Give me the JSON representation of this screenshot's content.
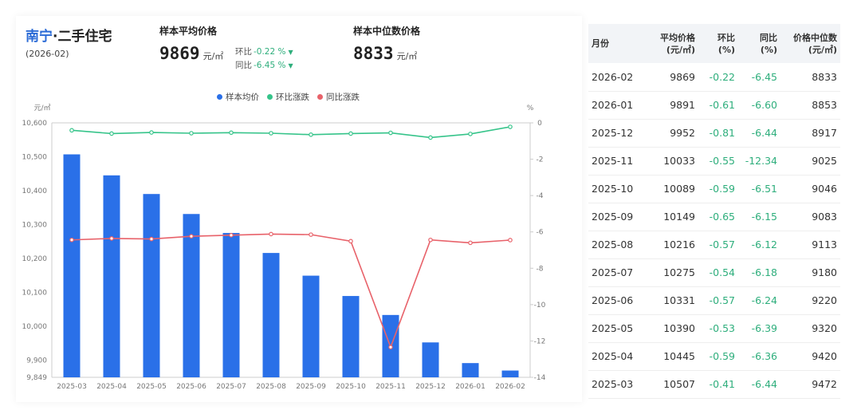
{
  "header": {
    "city": "南宁",
    "category": "·二手住宅",
    "date": "(2026-02)",
    "avg_label": "样本平均价格",
    "avg_value": "9869",
    "avg_unit": "元/㎡",
    "mom_label": "环比",
    "mom_value": "-0.22 %",
    "yoy_label": "同比",
    "yoy_value": "-6.45 %",
    "median_label": "样本中位数价格",
    "median_value": "8833",
    "median_unit": "元/㎡"
  },
  "chart_data": {
    "type": "bar",
    "left_axis_unit": "元/㎡",
    "right_axis_unit": "%",
    "ylim": [
      9849,
      10600
    ],
    "y_ticks": [
      9849,
      9900,
      10000,
      10100,
      10200,
      10300,
      10400,
      10500,
      10600
    ],
    "y_tick_labels": [
      "9,849",
      "9,900",
      "10,000",
      "10,100",
      "10,200",
      "10,300",
      "10,400",
      "10,500",
      "10,600"
    ],
    "y2lim": [
      -14,
      0
    ],
    "y2_ticks": [
      0,
      -2,
      -4,
      -6,
      -8,
      -10,
      -12,
      -14
    ],
    "legend": [
      "样本均价",
      "环比涨跌",
      "同比涨跌"
    ],
    "legend_position": "top",
    "categories": [
      "2025-03",
      "2025-04",
      "2025-05",
      "2025-06",
      "2025-07",
      "2025-08",
      "2025-09",
      "2025-10",
      "2025-11",
      "2025-12",
      "2026-01",
      "2026-02"
    ],
    "series": [
      {
        "name": "样本均价",
        "kind": "bar",
        "axis": "left",
        "color": "#2a70e8",
        "values": [
          10507,
          10445,
          10390,
          10331,
          10275,
          10216,
          10149,
          10089,
          10033,
          9952,
          9891,
          9869
        ]
      },
      {
        "name": "环比涨跌",
        "kind": "line",
        "axis": "right",
        "color": "#36c48a",
        "values": [
          -0.41,
          -0.59,
          -0.53,
          -0.57,
          -0.54,
          -0.57,
          -0.65,
          -0.59,
          -0.55,
          -0.81,
          -0.61,
          -0.22
        ]
      },
      {
        "name": "同比涨跌",
        "kind": "line",
        "axis": "right",
        "color": "#e8626a",
        "values": [
          -6.44,
          -6.36,
          -6.39,
          -6.24,
          -6.18,
          -6.12,
          -6.15,
          -6.51,
          -12.34,
          -6.44,
          -6.6,
          -6.45
        ]
      }
    ],
    "grid": false
  },
  "table": {
    "headers": [
      "月份",
      "平均价格\n(元/㎡)",
      "环比\n(%)",
      "同比\n(%)",
      "价格中位数\n(元/㎡)"
    ],
    "rows": [
      [
        "2026-02",
        "9869",
        "-0.22",
        "-6.45",
        "8833"
      ],
      [
        "2026-01",
        "9891",
        "-0.61",
        "-6.60",
        "8853"
      ],
      [
        "2025-12",
        "9952",
        "-0.81",
        "-6.44",
        "8917"
      ],
      [
        "2025-11",
        "10033",
        "-0.55",
        "-12.34",
        "9025"
      ],
      [
        "2025-10",
        "10089",
        "-0.59",
        "-6.51",
        "9046"
      ],
      [
        "2025-09",
        "10149",
        "-0.65",
        "-6.15",
        "9083"
      ],
      [
        "2025-08",
        "10216",
        "-0.57",
        "-6.12",
        "9113"
      ],
      [
        "2025-07",
        "10275",
        "-0.54",
        "-6.18",
        "9180"
      ],
      [
        "2025-06",
        "10331",
        "-0.57",
        "-6.24",
        "9220"
      ],
      [
        "2025-05",
        "10390",
        "-0.53",
        "-6.39",
        "9320"
      ],
      [
        "2025-04",
        "10445",
        "-0.59",
        "-6.36",
        "9420"
      ],
      [
        "2025-03",
        "10507",
        "-0.41",
        "-6.44",
        "9472"
      ]
    ]
  },
  "colors": {
    "accent_blue": "#2b6bd6",
    "change_green": "#2eae7c"
  }
}
